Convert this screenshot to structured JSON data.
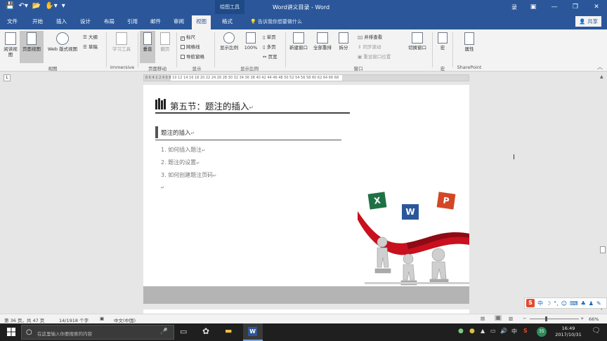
{
  "titlebar": {
    "context_tab": "绘图工具",
    "title": "Word讲义目录 - Word",
    "user": "录",
    "min": "—",
    "restore": "❐",
    "close": "✕",
    "ribbon_opts": "▣"
  },
  "tabs": {
    "items": [
      "文件",
      "开始",
      "插入",
      "设计",
      "布局",
      "引用",
      "邮件",
      "审阅",
      "视图",
      "格式"
    ],
    "active": "视图",
    "tell_me": "告诉我你想要做什么",
    "share": "共享"
  },
  "ribbon": {
    "views": {
      "read_mode": "阅读视图",
      "print_layout": "页面视图",
      "web_layout": "Web 版式视图",
      "outline": "大纲",
      "draft": "草稿",
      "group_label": "视图"
    },
    "immersive": {
      "learning_tools": "学习工具",
      "group_label": "Immersive"
    },
    "page_movement": {
      "vertical": "垂直",
      "side_to_side": "翻页",
      "group_label": "页面移动"
    },
    "show": {
      "ruler": "标尺",
      "gridlines": "网格线",
      "nav_pane": "导航窗格",
      "group_label": "显示"
    },
    "zoom": {
      "zoom": "显示比例",
      "zoom100": "100%",
      "one_page": "单页",
      "multi_page": "多页",
      "page_width": "页宽",
      "group_label": "显示比例"
    },
    "window": {
      "new_window": "新建窗口",
      "arrange_all": "全部重排",
      "split": "拆分",
      "side_by_side": "并排查看",
      "sync_scroll": "同步滚动",
      "reset_position": "重设窗口位置",
      "switch_windows": "切换窗口",
      "group_label": "窗口"
    },
    "macros": {
      "macros": "宏",
      "group_label": "宏"
    },
    "sharepoint": {
      "properties": "属性",
      "group_label": "SharePoint"
    }
  },
  "ruler": {
    "ticks": "8  6  4  2     2  4  6  8  10  12  14  16  18  20  22  24  26  28  30  32  34  36  38  40  42  44  46  48  50  52  54  56  58  60  62  64  66  68"
  },
  "document": {
    "heading": "第五节：题注的插入",
    "subheading": "题注的插入",
    "list": [
      "1. 如何插入题注",
      "2. 题注的设置",
      "3. 如何创建题注页码"
    ],
    "para_mark": "↵",
    "app_icons": {
      "excel": "X",
      "word": "W",
      "powerpoint": "P"
    }
  },
  "statusbar": {
    "page": "第 36 页，共 47 页",
    "words": "14/1918 个字",
    "language": "中文(中国)",
    "zoom": "66%",
    "zoom_level": 0.66
  },
  "ime": {
    "logo": "S",
    "mode": "中"
  },
  "taskbar": {
    "search_placeholder": "在这里输入你要搜索的内容",
    "tray_ime": "中",
    "tray_badge": "35",
    "time": "16:49",
    "date": "2017/10/31"
  },
  "colors": {
    "word_blue": "#2b579a",
    "excel_green": "#1e7145",
    "ppt_red": "#d24726",
    "ribbon_red": "#c8101e"
  }
}
